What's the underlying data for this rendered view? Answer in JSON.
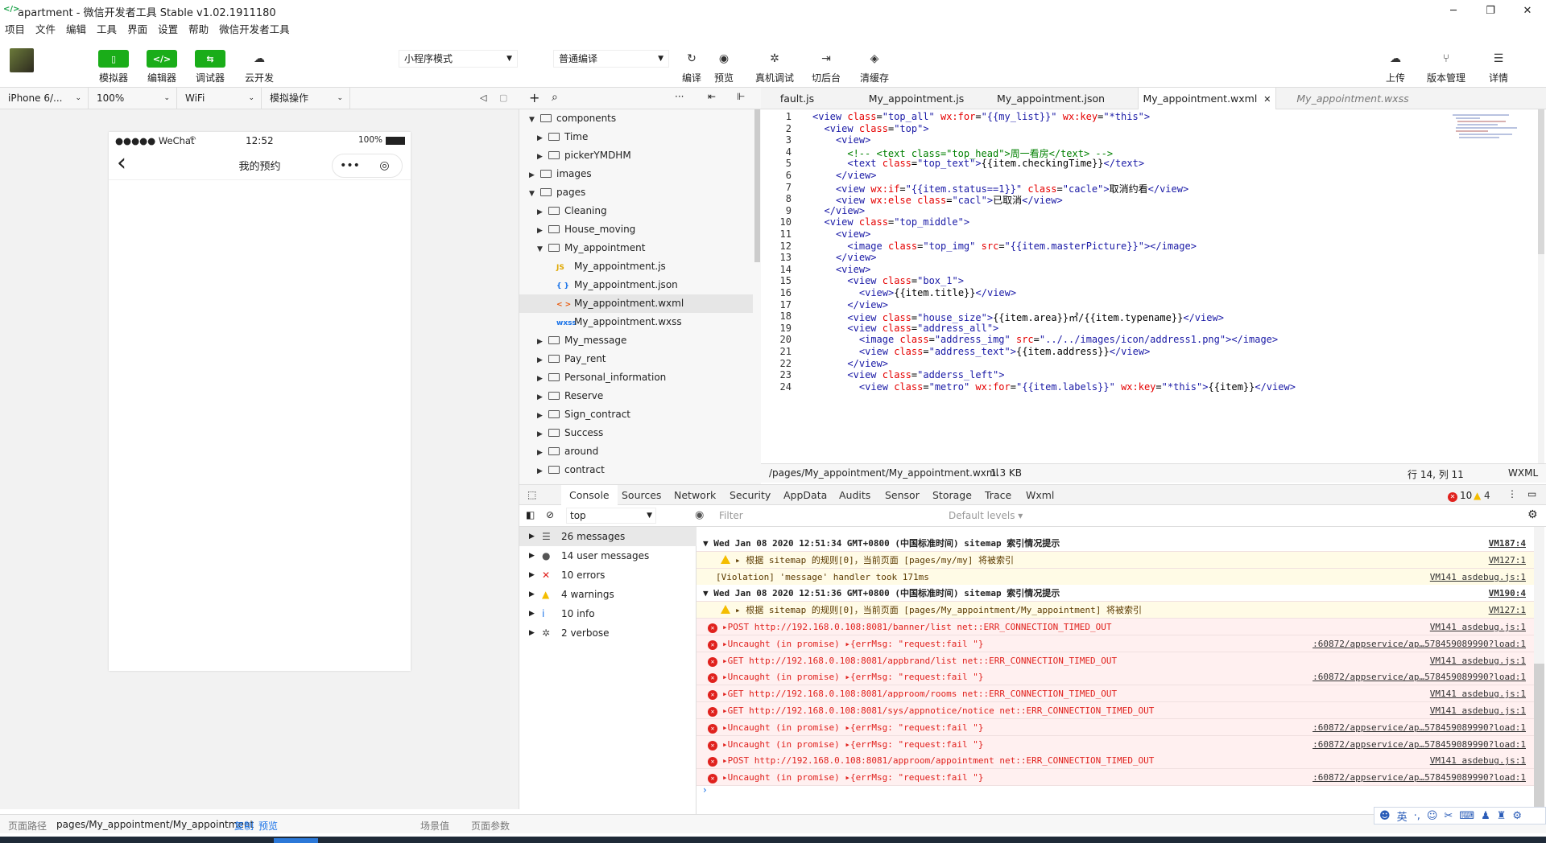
{
  "window": {
    "title": "apartment - 微信开发者工具 Stable v1.02.1911180",
    "minimize": "─",
    "maximize": "❐",
    "close": "✕"
  },
  "menu": [
    "项目",
    "文件",
    "编辑",
    "工具",
    "界面",
    "设置",
    "帮助",
    "微信开发者工具"
  ],
  "toolbar": {
    "simulator": "模拟器",
    "editor": "编辑器",
    "debugger": "调试器",
    "cloud": "云开发",
    "mode": "小程序模式",
    "compile_mode": "普通编译",
    "compile": "编译",
    "preview": "预览",
    "remote_debug": "真机调试",
    "background": "切后台",
    "clear_cache": "清缓存",
    "upload": "上传",
    "version": "版本管理",
    "details": "详情"
  },
  "simbar": {
    "device": "iPhone 6/...",
    "zoom": "100%",
    "network": "WiFi",
    "operation": "模拟操作"
  },
  "phone": {
    "carrier": "●●●●● WeChat",
    "time": "12:52",
    "battery": "100%",
    "title": "我的预约",
    "back": "‹"
  },
  "filetree": [
    {
      "label": "components",
      "type": "folder",
      "open": true,
      "level": 0
    },
    {
      "label": "Time",
      "type": "folder",
      "open": false,
      "level": 1
    },
    {
      "label": "pickerYMDHM",
      "type": "folder",
      "open": false,
      "level": 1
    },
    {
      "label": "images",
      "type": "folder",
      "open": false,
      "level": 0
    },
    {
      "label": "pages",
      "type": "folder",
      "open": true,
      "level": 0
    },
    {
      "label": "Cleaning",
      "type": "folder",
      "open": false,
      "level": 1
    },
    {
      "label": "House_moving",
      "type": "folder",
      "open": false,
      "level": 1
    },
    {
      "label": "My_appointment",
      "type": "folder",
      "open": true,
      "level": 1
    },
    {
      "label": "My_appointment.js",
      "type": "js",
      "level": 2
    },
    {
      "label": "My_appointment.json",
      "type": "json",
      "level": 2
    },
    {
      "label": "My_appointment.wxml",
      "type": "wxml",
      "level": 2,
      "selected": true
    },
    {
      "label": "My_appointment.wxss",
      "type": "wxss",
      "level": 2
    },
    {
      "label": "My_message",
      "type": "folder",
      "open": false,
      "level": 1
    },
    {
      "label": "Pay_rent",
      "type": "folder",
      "open": false,
      "level": 1
    },
    {
      "label": "Personal_information",
      "type": "folder",
      "open": false,
      "level": 1
    },
    {
      "label": "Reserve",
      "type": "folder",
      "open": false,
      "level": 1
    },
    {
      "label": "Sign_contract",
      "type": "folder",
      "open": false,
      "level": 1
    },
    {
      "label": "Success",
      "type": "folder",
      "open": false,
      "level": 1
    },
    {
      "label": "around",
      "type": "folder",
      "open": false,
      "level": 1
    },
    {
      "label": "contract",
      "type": "folder",
      "open": false,
      "level": 1
    }
  ],
  "tabs": [
    "fault.js",
    "My_appointment.js",
    "My_appointment.json",
    "My_appointment.wxml",
    "My_appointment.wxss"
  ],
  "code": [
    "<view class=\"top_all\" wx:for=\"{{my_list}}\" wx:key=\"*this\">",
    "  <view class=\"top\">",
    "    <view>",
    "      <!-- <text class=\"top_head\">周一看房</text> -->",
    "      <text class=\"top_text\">{{item.checkingTime}}</text>",
    "    </view>",
    "    <view wx:if=\"{{item.status==1}}\" class=\"cacle\">取消约看</view>",
    "    <view wx:else class=\"cacl\">已取消</view>",
    "  </view>",
    "  <view class=\"top_middle\">",
    "    <view>",
    "      <image class=\"top_img\" src=\"{{item.masterPicture}}\"></image>",
    "    </view>",
    "    <view>",
    "      <view class=\"box_1\">",
    "        <view>{{item.title}}</view>",
    "      </view>",
    "      <view class=\"house_size\">{{item.area}}㎡/{{item.typename}}</view>",
    "      <view class=\"address_all\">",
    "        <image class=\"address_img\" src=\"../../images/icon/address1.png\"></image>",
    "        <view class=\"address_text\">{{item.address}}</view>",
    "      </view>",
    "      <view class=\"adderss_left\">",
    "        <view class=\"metro\" wx:for=\"{{item.labels}}\" wx:key=\"*this\">{{item}}</view>"
  ],
  "edstatus": {
    "path": "/pages/My_appointment/My_appointment.wxml",
    "size": "1.3 KB",
    "pos": "行 14, 列 11",
    "lang": "WXML"
  },
  "devtabs": [
    "Console",
    "Sources",
    "Network",
    "Security",
    "AppData",
    "Audits",
    "Sensor",
    "Storage",
    "Trace",
    "Wxml"
  ],
  "devcounts": {
    "errors": "10",
    "warnings": "4"
  },
  "consolebar": {
    "context": "top",
    "filter": "Filter",
    "levels": "Default levels ▾"
  },
  "sidebar": [
    {
      "label": "26 messages",
      "icon": "list"
    },
    {
      "label": "14 user messages",
      "icon": "user"
    },
    {
      "label": "10 errors",
      "icon": "error"
    },
    {
      "label": "4 warnings",
      "icon": "warning"
    },
    {
      "label": "10 info",
      "icon": "info"
    },
    {
      "label": "2 verbose",
      "icon": "verbose"
    }
  ],
  "console": [
    {
      "type": "grp",
      "text": "▼ Wed Jan 08 2020 12:51:34 GMT+0800 (中国标准时间) sitemap 索引情况提示",
      "src": "VM187:4"
    },
    {
      "type": "warn",
      "text": "▸ 根据 sitemap 的规则[0]，当前页面 [pages/my/my] 将被索引",
      "src": "VM127:1"
    },
    {
      "type": "warn2",
      "text": "[Violation] 'message' handler took 171ms",
      "src": "VM141 asdebug.js:1"
    },
    {
      "type": "grp",
      "text": "▼ Wed Jan 08 2020 12:51:36 GMT+0800 (中国标准时间) sitemap 索引情况提示",
      "src": "VM190:4"
    },
    {
      "type": "warn",
      "text": "▸ 根据 sitemap 的规则[0]，当前页面 [pages/My_appointment/My_appointment] 将被索引",
      "src": "VM127:1"
    },
    {
      "type": "err",
      "text": "▸POST http://192.168.0.108:8081/banner/list net::ERR_CONNECTION_TIMED_OUT",
      "src": "VM141 asdebug.js:1"
    },
    {
      "type": "err",
      "text": "▸Uncaught (in promise) ▸{errMsg: \"request:fail \"}",
      "src": ":60872/appservice/ap…578459089990?load:1"
    },
    {
      "type": "err",
      "text": "▸GET http://192.168.0.108:8081/appbrand/list net::ERR_CONNECTION_TIMED_OUT",
      "src": "VM141 asdebug.js:1"
    },
    {
      "type": "err",
      "text": "▸Uncaught (in promise) ▸{errMsg: \"request:fail \"}",
      "src": ":60872/appservice/ap…578459089990?load:1"
    },
    {
      "type": "err",
      "text": "▸GET http://192.168.0.108:8081/approom/rooms net::ERR_CONNECTION_TIMED_OUT",
      "src": "VM141 asdebug.js:1"
    },
    {
      "type": "err",
      "text": "▸GET http://192.168.0.108:8081/sys/appnotice/notice net::ERR_CONNECTION_TIMED_OUT",
      "src": "VM141 asdebug.js:1"
    },
    {
      "type": "err",
      "text": "▸Uncaught (in promise) ▸{errMsg: \"request:fail \"}",
      "src": ":60872/appservice/ap…578459089990?load:1"
    },
    {
      "type": "err",
      "text": "▸Uncaught (in promise) ▸{errMsg: \"request:fail \"}",
      "src": ":60872/appservice/ap…578459089990?load:1"
    },
    {
      "type": "err",
      "text": "▸POST http://192.168.0.108:8081/approom/appointment net::ERR_CONNECTION_TIMED_OUT",
      "src": "VM141 asdebug.js:1"
    },
    {
      "type": "err",
      "text": "▸Uncaught (in promise) ▸{errMsg: \"request:fail \"}",
      "src": ":60872/appservice/ap…578459089990?load:1"
    }
  ],
  "bottombar": {
    "path_label": "页面路径",
    "path": "pages/My_appointment/My_appointment",
    "copy": "复制",
    "preview": "预览",
    "scene": "场景值",
    "params": "页面参数"
  },
  "colors": {
    "accent": "#1aad19",
    "error": "#e0211d",
    "warning": "#f4bd00"
  }
}
